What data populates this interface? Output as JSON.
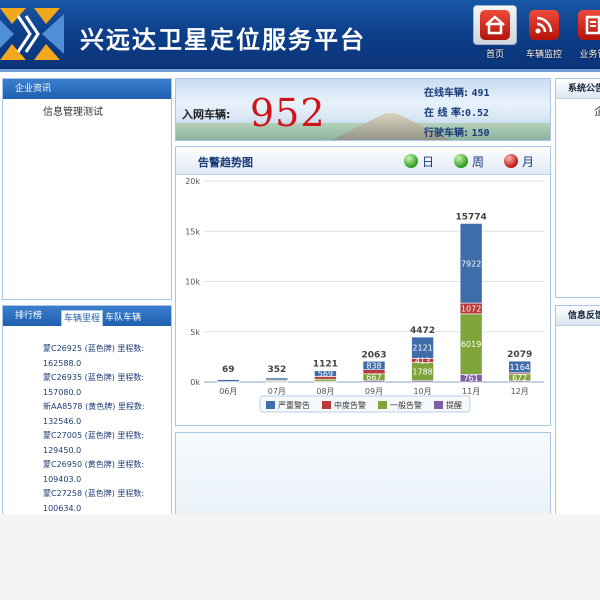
{
  "header": {
    "title": "兴远达卫星定位服务平台",
    "nav": [
      {
        "label": "首页",
        "icon": "home-icon"
      },
      {
        "label": "车辆监控",
        "icon": "rss-icon"
      },
      {
        "label": "业务管",
        "icon": "document-icon"
      }
    ]
  },
  "left": {
    "news": {
      "title": "企业资讯",
      "item": "信息管理测试"
    },
    "ranking": {
      "title": "排行榜",
      "tabs": [
        "车辆里程",
        "车队车辆"
      ],
      "items": [
        {
          "line1": "蒙C26925 (蓝色牌) 里程数:",
          "line2": "162588.0"
        },
        {
          "line1": "蒙C26935 (蓝色牌) 里程数:",
          "line2": "157080.0"
        },
        {
          "line1": "新AA8578 (黄色牌) 里程数:",
          "line2": "132546.0"
        },
        {
          "line1": "蒙C27005 (蓝色牌) 里程数:",
          "line2": "129450.0"
        },
        {
          "line1": "蒙C26950 (黄色牌) 里程数:",
          "line2": "109403.0"
        },
        {
          "line1": "蒙C27258 (蓝色牌) 里程数:",
          "line2": "100634.0"
        }
      ]
    }
  },
  "banner": {
    "label": "入网车辆:",
    "count": "952",
    "stats": [
      {
        "label": "在线车辆:",
        "value": "491"
      },
      {
        "label": "在 线 率:",
        "value": "0.52"
      },
      {
        "label": "行驶车辆:",
        "value": "150"
      }
    ]
  },
  "alarm": {
    "title": "告警趋势图",
    "periods": [
      "日",
      "周",
      "月"
    ]
  },
  "chart_data": {
    "type": "bar",
    "stacked": true,
    "categories": [
      "06月",
      "07月",
      "08月",
      "09月",
      "10月",
      "11月",
      "12月"
    ],
    "y_ticks": [
      "0k",
      "5k",
      "10k",
      "15k",
      "20k"
    ],
    "ylim": [
      0,
      20000
    ],
    "grid": true,
    "legend_position": "bottom",
    "totals": [
      69,
      352,
      1121,
      2063,
      4472,
      15774,
      2079
    ],
    "series": [
      {
        "name": "提醒",
        "color": "#7d5fa5",
        "values": [
          10,
          50,
          80,
          150,
          150,
          761,
          122
        ]
      },
      {
        "name": "一般告警",
        "color": "#7fa43c",
        "values": [
          20,
          100,
          200,
          667,
          1788,
          6019,
          672
        ]
      },
      {
        "name": "中度告警",
        "color": "#b83a3a",
        "values": [
          9,
          52,
          272,
          408,
          413,
          1072,
          121
        ]
      },
      {
        "name": "严重警告",
        "color": "#3e6daa",
        "values": [
          30,
          150,
          569,
          838,
          2121,
          7922,
          1164
        ]
      }
    ],
    "data_labels": [
      {
        "category": "09月",
        "series": "严重警告",
        "text": "838"
      },
      {
        "category": "09月",
        "series": "一般告警",
        "text": "667"
      },
      {
        "category": "08月",
        "series": "严重警告",
        "text": "569"
      },
      {
        "category": "10月",
        "series": "严重警告",
        "text": "2121"
      },
      {
        "category": "10月",
        "series": "中度告警",
        "text": "413"
      },
      {
        "category": "10月",
        "series": "一般告警",
        "text": "1788"
      },
      {
        "category": "11月",
        "series": "严重警告",
        "text": "7922"
      },
      {
        "category": "11月",
        "series": "中度告警",
        "text": "1072"
      },
      {
        "category": "11月",
        "series": "一般告警",
        "text": "6019"
      },
      {
        "category": "11月",
        "series": "提醒",
        "text": "761"
      },
      {
        "category": "12月",
        "series": "严重警告",
        "text": "1164"
      },
      {
        "category": "12月",
        "series": "一般告警",
        "text": "672"
      }
    ],
    "legend_order": [
      "严重警告",
      "中度告警",
      "一般告警",
      "提醒"
    ]
  },
  "right": {
    "notice": {
      "title": "系统公告",
      "item": "企"
    },
    "feedback": {
      "title": "信息反馈"
    }
  }
}
